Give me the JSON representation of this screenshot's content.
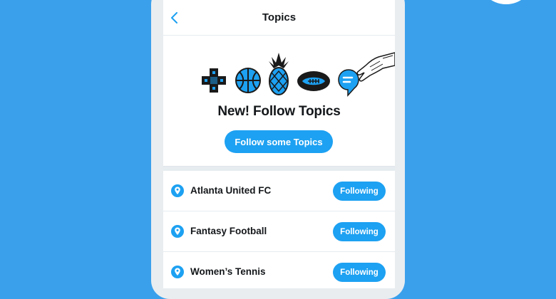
{
  "header": {
    "title": "Topics",
    "back_icon": "chevron-left-icon"
  },
  "promo": {
    "icons": [
      "dpad-icon",
      "basketball-icon",
      "pineapple-icon",
      "football-icon",
      "topic-bubble-icon",
      "hand-icon"
    ],
    "title": "New! Follow Topics",
    "cta_label": "Follow some Topics"
  },
  "topics": [
    {
      "name": "Atlanta United FC",
      "button": "Following",
      "icon": "location-pin-icon"
    },
    {
      "name": "Fantasy Football",
      "button": "Following",
      "icon": "location-pin-icon"
    },
    {
      "name": "Women’s Tennis",
      "button": "Following",
      "icon": "location-pin-icon"
    }
  ],
  "colors": {
    "background": "#3aa0ec",
    "accent": "#1da1f2",
    "text": "#14171a"
  }
}
